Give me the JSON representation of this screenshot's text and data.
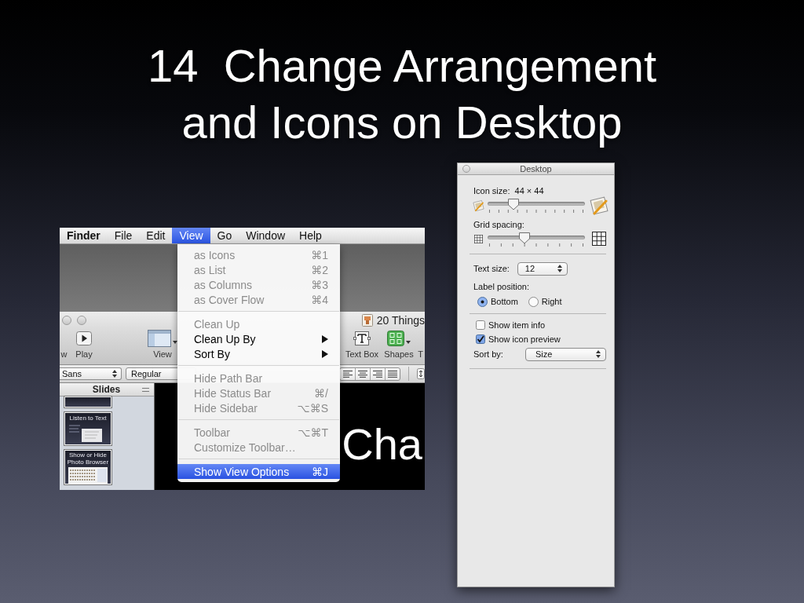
{
  "title": [
    "14  Change Arrangement",
    "and Icons on Desktop"
  ],
  "screenshot": {
    "menu_bar": [
      {
        "label": "Finder",
        "kind": "app",
        "selected": false
      },
      {
        "label": "File",
        "kind": "menu",
        "selected": false
      },
      {
        "label": "Edit",
        "kind": "menu",
        "selected": false
      },
      {
        "label": "View",
        "kind": "menu",
        "selected": true
      },
      {
        "label": "Go",
        "kind": "menu",
        "selected": false
      },
      {
        "label": "Window",
        "kind": "menu",
        "selected": false
      },
      {
        "label": "Help",
        "kind": "menu",
        "selected": false
      }
    ],
    "view_menu": [
      {
        "kind": "item",
        "label": "as Icons",
        "shortcut": "⌘1",
        "disabled": true,
        "selected": false,
        "submenu": false
      },
      {
        "kind": "item",
        "label": "as List",
        "shortcut": "⌘2",
        "disabled": true,
        "selected": false,
        "submenu": false
      },
      {
        "kind": "item",
        "label": "as Columns",
        "shortcut": "⌘3",
        "disabled": true,
        "selected": false,
        "submenu": false
      },
      {
        "kind": "item",
        "label": "as Cover Flow",
        "shortcut": "⌘4",
        "disabled": true,
        "selected": false,
        "submenu": false
      },
      {
        "kind": "separator"
      },
      {
        "kind": "item",
        "label": "Clean Up",
        "disabled": true,
        "selected": false,
        "submenu": false
      },
      {
        "kind": "item",
        "label": "Clean Up By",
        "disabled": false,
        "selected": false,
        "submenu": true
      },
      {
        "kind": "item",
        "label": "Sort By",
        "disabled": false,
        "selected": false,
        "submenu": true
      },
      {
        "kind": "separator"
      },
      {
        "kind": "item",
        "label": "Hide Path Bar",
        "disabled": true,
        "selected": false,
        "submenu": false
      },
      {
        "kind": "item",
        "label": "Hide Status Bar",
        "shortcut": "⌘/",
        "disabled": true,
        "selected": false,
        "submenu": false
      },
      {
        "kind": "item",
        "label": "Hide Sidebar",
        "shortcut": "⌥⌘S",
        "disabled": true,
        "selected": false,
        "submenu": false
      },
      {
        "kind": "separator"
      },
      {
        "kind": "item",
        "label": "Toolbar",
        "shortcut": "⌥⌘T",
        "disabled": true,
        "selected": false,
        "submenu": false
      },
      {
        "kind": "item",
        "label": "Customize Toolbar…",
        "disabled": true,
        "selected": false,
        "submenu": false
      },
      {
        "kind": "separator"
      },
      {
        "kind": "item",
        "label": "Show View Options",
        "shortcut": "⌘J",
        "disabled": false,
        "selected": true,
        "submenu": false
      }
    ],
    "window": {
      "title": "20 Things",
      "toolbar": [
        {
          "label": "w",
          "kind": "blank"
        },
        {
          "label": "Play",
          "kind": "play"
        },
        {
          "label": "View",
          "kind": "view"
        },
        {
          "label": "Text Box",
          "kind": "text-box"
        },
        {
          "label": "Shapes",
          "kind": "shapes"
        },
        {
          "label": "T",
          "kind": "blank"
        }
      ],
      "font_family": "Sans",
      "font_style": "Regular",
      "sidebar_title": "Slides",
      "thumbnails": [
        {
          "kind": "cut"
        },
        {
          "kind": "text",
          "title": "Listen to Text"
        },
        {
          "kind": "photos",
          "title": "Show or Hide Photo Browser"
        }
      ],
      "canvas_text": "Cha"
    }
  },
  "panel": {
    "title": "Desktop",
    "rows": [
      {
        "kind": "label",
        "text": "Icon size:  44 × 44"
      },
      {
        "kind": "slider",
        "slider": {
          "kind": "picture",
          "level": 0.27
        }
      },
      {
        "kind": "label",
        "text": "Grid spacing:"
      },
      {
        "kind": "slider",
        "slider": {
          "kind": "grid",
          "level": 0.38
        }
      },
      {
        "kind": "separator"
      },
      {
        "kind": "popup",
        "label": "Text size:",
        "value": "12"
      },
      {
        "kind": "label",
        "text": "Label position:"
      },
      {
        "kind": "radios",
        "options": [
          {
            "label": "Bottom",
            "selected": true
          },
          {
            "label": "Right",
            "selected": false
          }
        ]
      },
      {
        "kind": "separator"
      },
      {
        "kind": "checkbox",
        "label": "Show item info",
        "checked": false
      },
      {
        "kind": "checkbox",
        "label": "Show icon preview",
        "checked": true
      },
      {
        "kind": "popup",
        "label": "Sort by:",
        "value": "Size"
      },
      {
        "kind": "separator"
      }
    ]
  }
}
